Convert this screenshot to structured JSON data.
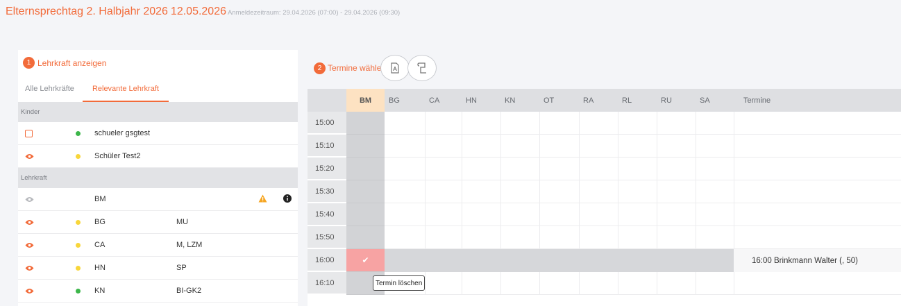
{
  "header": {
    "title": "Elternsprechtag 2. Halbjahr 2026",
    "date": "12.05.2026",
    "registration": "Anmeldezeitraum: 29.04.2026 (07:00) - 29.04.2026 (09:30)"
  },
  "left": {
    "step_number": "1",
    "step_label": "Lehrkraft anzeigen",
    "tabs": [
      {
        "label": "Alle Lehrkräfte"
      },
      {
        "label": "Relevante Lehrkraft"
      }
    ],
    "children_header": "Kinder",
    "children": [
      {
        "name": "schueler gsgtest",
        "icon": "checkbox-icon",
        "dot": "#3cb64a"
      },
      {
        "name": "Schüler Test2",
        "icon": "eye-icon",
        "dot": "#f8d63a"
      }
    ],
    "teachers_header": "Lehrkraft",
    "teachers": [
      {
        "name": "BM",
        "subjects": "",
        "dot": "",
        "active": false
      },
      {
        "name": "BG",
        "subjects": "MU",
        "dot": "#f8d63a",
        "active": true
      },
      {
        "name": "CA",
        "subjects": "M, LZM",
        "dot": "#f8d63a",
        "active": true
      },
      {
        "name": "HN",
        "subjects": "SP",
        "dot": "#f8d63a",
        "active": true
      },
      {
        "name": "KN",
        "subjects": "BI-GK2",
        "dot": "#3cb64a",
        "active": true
      }
    ]
  },
  "right": {
    "step_number": "2",
    "step_label": "Termine wählen",
    "columns": [
      "BM",
      "BG",
      "CA",
      "HN",
      "KN",
      "OT",
      "RA",
      "RL",
      "RU",
      "SA",
      "Termine"
    ],
    "times": [
      "15:00",
      "15:10",
      "15:20",
      "15:30",
      "15:40",
      "15:50",
      "16:00",
      "16:10"
    ],
    "booked_time": "16:00",
    "booked_text": "16:00 Brinkmann Walter (, 50)",
    "tooltip": "Termin löschen"
  },
  "colors": {
    "accent": "#f26b3a",
    "selected_column": "#fde2c2",
    "booked": "#f7a3a3"
  }
}
